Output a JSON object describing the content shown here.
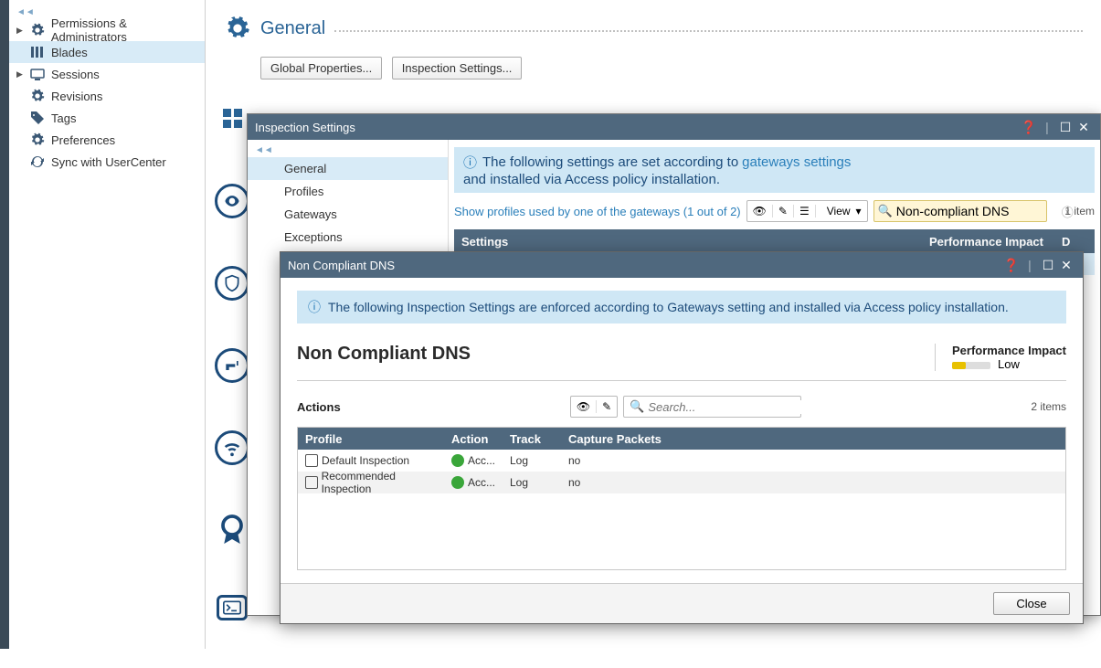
{
  "sidebar": {
    "items": [
      {
        "label": "Permissions & Administrators",
        "icon": "gear-icon",
        "arrow": true
      },
      {
        "label": "Blades",
        "icon": "blades-icon",
        "arrow": false,
        "selected": true
      },
      {
        "label": "Sessions",
        "icon": "sessions-icon",
        "arrow": true
      },
      {
        "label": "Revisions",
        "icon": "gear-icon",
        "arrow": false
      },
      {
        "label": "Tags",
        "icon": "tag-icon",
        "arrow": false
      },
      {
        "label": "Preferences",
        "icon": "gear-icon",
        "arrow": false
      },
      {
        "label": "Sync with UserCenter",
        "icon": "sync-icon",
        "arrow": false
      }
    ]
  },
  "main": {
    "title": "General",
    "buttons": {
      "global": "Global Properties...",
      "insp": "Inspection Settings..."
    }
  },
  "inspection": {
    "title": "Inspection Settings",
    "nav": [
      "General",
      "Profiles",
      "Gateways",
      "Exceptions"
    ],
    "info_prefix": "The following settings are set according to ",
    "info_link": "gateways settings",
    "info_suffix": " and installed via Access policy installation.",
    "show_profiles": "Show profiles used by one of the gateways (1 out of 2)",
    "view_label": "View",
    "search_value": "Non-compliant DNS",
    "item_count": "1 item",
    "headers": {
      "settings": "Settings",
      "perf": "Performance Impact",
      "d": "D"
    },
    "row_name": "Non Compliant DNS"
  },
  "dns": {
    "title": "Non Compliant DNS",
    "info": "The following Inspection Settings are enforced according to Gateways setting and installed via Access policy installation.",
    "heading": "Non Compliant DNS",
    "perf_label": "Performance Impact",
    "perf_value": "Low",
    "actions_label": "Actions",
    "search_placeholder": "Search...",
    "item_count": "2 items",
    "cols": {
      "profile": "Profile",
      "action": "Action",
      "track": "Track",
      "capture": "Capture Packets"
    },
    "rows": [
      {
        "profile": "Default Inspection",
        "action": "Acc...",
        "track": "Log",
        "capture": "no"
      },
      {
        "profile": "Recommended Inspection",
        "action": "Acc...",
        "track": "Log",
        "capture": "no"
      }
    ],
    "close": "Close"
  }
}
